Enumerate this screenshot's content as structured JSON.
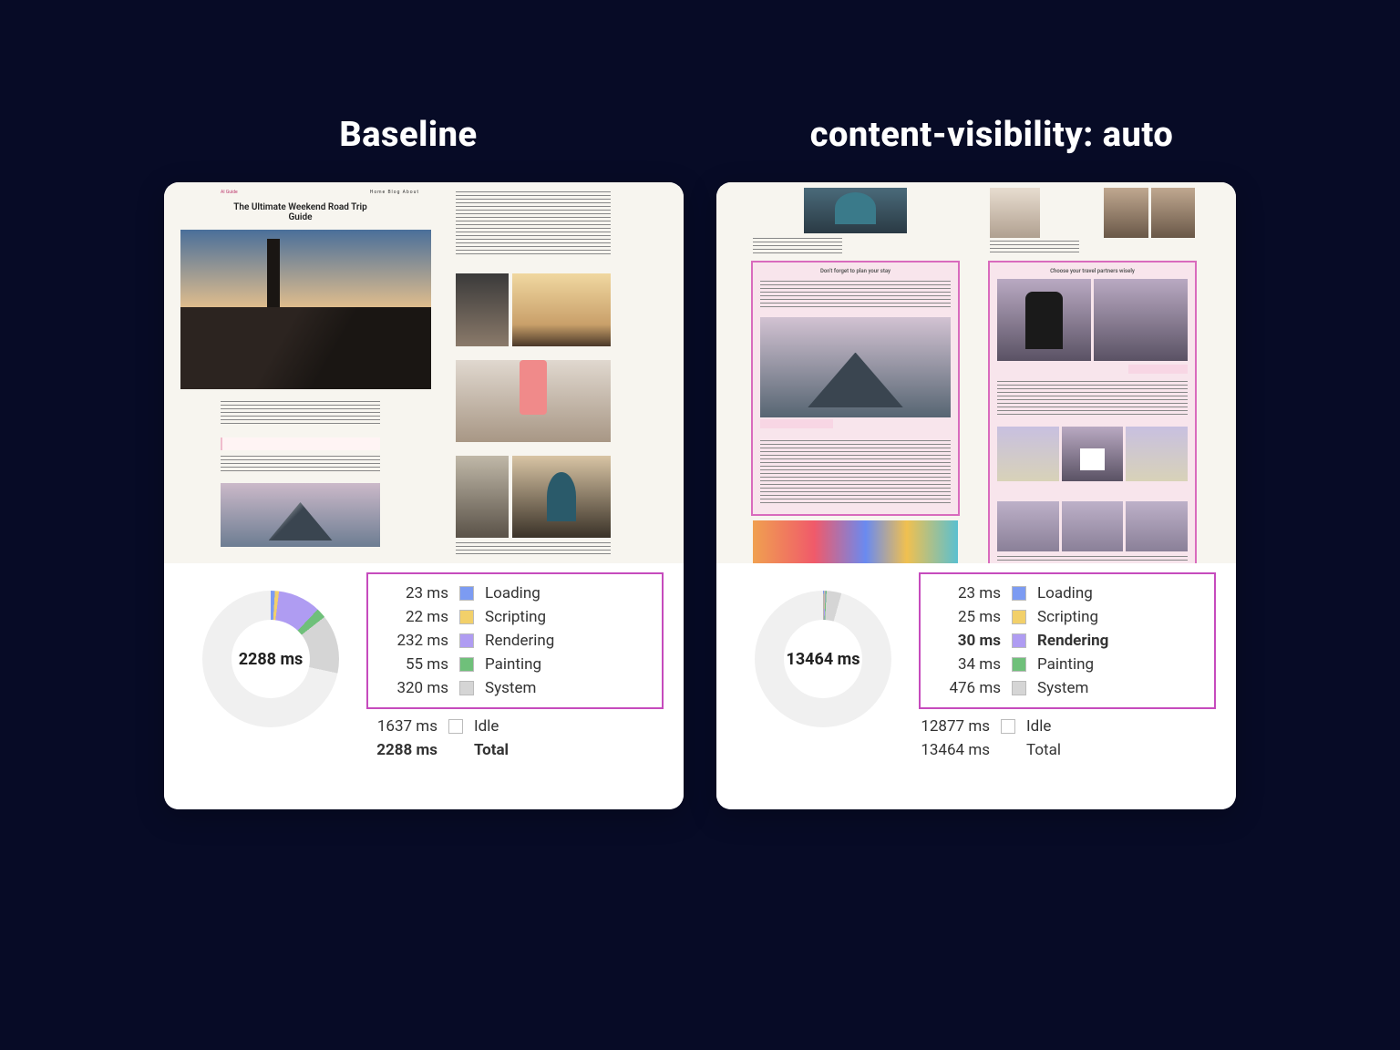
{
  "titles": {
    "left": "Baseline",
    "right": "content-visibility: auto"
  },
  "preview": {
    "baseline": {
      "brand": "AI Guide",
      "nav": "Home  Blog  About",
      "heading": "The Ultimate Weekend Road Trip Guide"
    },
    "cv": {
      "section1": "Don't forget to plan your stay",
      "section2": "Choose your travel partners wisely"
    }
  },
  "metrics": {
    "unit": "ms",
    "labels": {
      "loading": "Loading",
      "scripting": "Scripting",
      "rendering": "Rendering",
      "painting": "Painting",
      "system": "System",
      "idle": "Idle",
      "total": "Total"
    },
    "baseline": {
      "total": "2288 ms",
      "rows": {
        "loading": "23 ms",
        "scripting": "22 ms",
        "rendering": "232 ms",
        "painting": "55 ms",
        "system": "320 ms",
        "idle": "1637 ms",
        "total": "2288 ms"
      }
    },
    "cv": {
      "total": "13464 ms",
      "rows": {
        "loading": "23 ms",
        "scripting": "25 ms",
        "rendering": "30 ms",
        "painting": "34 ms",
        "system": "476 ms",
        "idle": "12877 ms",
        "total": "13464 ms"
      }
    }
  },
  "chart_data": [
    {
      "type": "pie",
      "title": "Baseline timing breakdown (donut)",
      "unit": "ms",
      "total": 2288,
      "series": [
        {
          "name": "Loading",
          "value": 23,
          "color": "#7c9bf2"
        },
        {
          "name": "Scripting",
          "value": 22,
          "color": "#f2d06a"
        },
        {
          "name": "Rendering",
          "value": 232,
          "color": "#af9cf2"
        },
        {
          "name": "Painting",
          "value": 55,
          "color": "#6fc07a"
        },
        {
          "name": "System",
          "value": 320,
          "color": "#d5d5d5"
        },
        {
          "name": "Idle",
          "value": 1637,
          "color": "#f3f3f3"
        }
      ]
    },
    {
      "type": "pie",
      "title": "content-visibility:auto timing breakdown (donut)",
      "unit": "ms",
      "total": 13464,
      "series": [
        {
          "name": "Loading",
          "value": 23,
          "color": "#7c9bf2"
        },
        {
          "name": "Scripting",
          "value": 25,
          "color": "#f2d06a"
        },
        {
          "name": "Rendering",
          "value": 30,
          "color": "#af9cf2"
        },
        {
          "name": "Painting",
          "value": 34,
          "color": "#6fc07a"
        },
        {
          "name": "System",
          "value": 476,
          "color": "#d5d5d5"
        },
        {
          "name": "Idle",
          "value": 12877,
          "color": "#f3f3f3"
        }
      ]
    }
  ]
}
